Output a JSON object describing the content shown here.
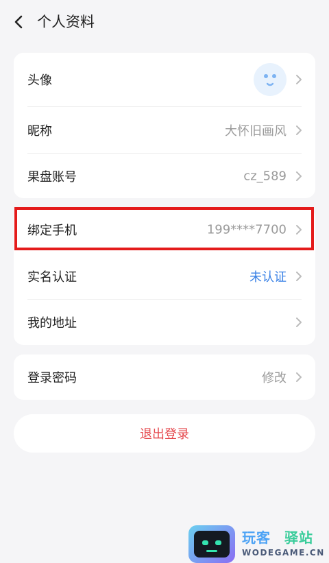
{
  "header": {
    "title": "个人资料"
  },
  "profile_card": {
    "avatar_label": "头像",
    "nickname_label": "昵称",
    "nickname_value": "大怀旧画风",
    "account_label": "果盘账号",
    "account_value": "cz_589"
  },
  "security_card": {
    "phone_label": "绑定手机",
    "phone_value": "199****7700",
    "realname_label": "实名认证",
    "realname_value": "未认证",
    "address_label": "我的地址"
  },
  "password_card": {
    "password_label": "登录密码",
    "password_value": "修改"
  },
  "logout": {
    "label": "退出登录"
  },
  "watermark": {
    "brand_a": "玩客",
    "brand_b": "驿站",
    "domain": "WODEGAME.CN"
  },
  "colors": {
    "highlight": "#e41b1b",
    "link_blue": "#3b82e6",
    "logout_red": "#e5484d"
  }
}
